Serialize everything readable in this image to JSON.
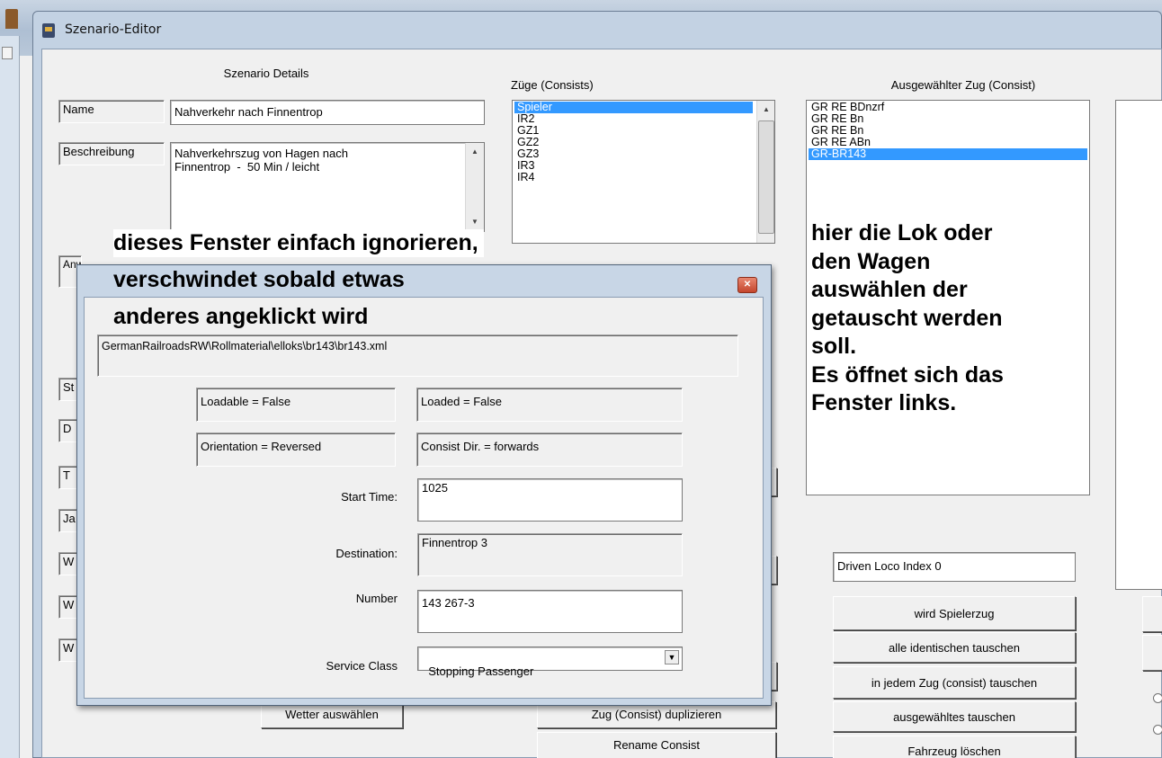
{
  "window": {
    "title": "Szenario-Editor"
  },
  "details": {
    "group_title": "Szenario Details",
    "name_label": "Name",
    "name_value": "Nahverkehr nach Finnentrop",
    "desc_label": "Beschreibung",
    "desc_value": "Nahverkehrszug von Hagen nach\nFinnentrop  -  50 Min / leicht",
    "partial_labels": [
      "Anwei",
      "St",
      "D",
      "T",
      "Ja",
      "W",
      "W",
      "W"
    ]
  },
  "consists": {
    "group_title": "Züge (Consists)",
    "items": [
      {
        "label": "Spieler",
        "selected": true
      },
      {
        "label": "IR2",
        "selected": false
      },
      {
        "label": "GZ1",
        "selected": false
      },
      {
        "label": "GZ2",
        "selected": false
      },
      {
        "label": "GZ3",
        "selected": false
      },
      {
        "label": "IR3",
        "selected": false
      },
      {
        "label": "IR4",
        "selected": false
      }
    ],
    "duplicate_button": "Zug (Consist) duplizieren",
    "rename_button": "Rename Consist"
  },
  "weather": {
    "button": "Wetter auswählen"
  },
  "selected_consist": {
    "group_title": "Ausgewählter Zug (Consist)",
    "items": [
      {
        "label": "GR RE BDnzrf",
        "selected": false
      },
      {
        "label": "GR RE Bn",
        "selected": false
      },
      {
        "label": "GR RE Bn",
        "selected": false
      },
      {
        "label": "GR RE ABn",
        "selected": false
      },
      {
        "label": "GR-BR143",
        "selected": true
      }
    ],
    "driven_loco": "Driven Loco Index 0",
    "buttons": {
      "player_train": "wird Spielerzug",
      "swap_identical": "alle identischen tauschen",
      "swap_every": "in jedem Zug (consist) tauschen",
      "swap_selected": "ausgewähltes tauschen",
      "delete_vehicle": "Fahrzeug löschen"
    }
  },
  "annotations": {
    "popup_note": [
      "dieses Fenster einfach ignorieren,",
      "verschwindet sobald etwas",
      "anderes angeklickt wird"
    ],
    "right_note": "hier die Lok oder\nden Wagen\nauswählen der\ngetauscht werden\nsoll.\nEs öffnet sich das\nFenster links."
  },
  "popup": {
    "path": "GermanRailroadsRW\\Rollmaterial\\elloks\\br143\\br143.xml",
    "loadable": "Loadable = False",
    "loaded": "Loaded = False",
    "orientation": "Orientation = Reversed",
    "consist_dir": "Consist Dir. = forwards",
    "start_time_label": "Start Time:",
    "start_time_value": "1025",
    "destination_label": "Destination:",
    "destination_value": "Finnentrop 3",
    "number_label": "Number",
    "number_value": "143 267-3",
    "service_class_label": "Service Class",
    "service_class_value": "Stopping Passenger"
  },
  "icons": {
    "close": "close-icon",
    "dropdown": "chevron-down-icon",
    "scroll_up": "scroll-up-icon",
    "scroll_down": "scroll-down-icon"
  },
  "colors": {
    "selection": "#3399ff",
    "close_button": "#c4462d"
  }
}
